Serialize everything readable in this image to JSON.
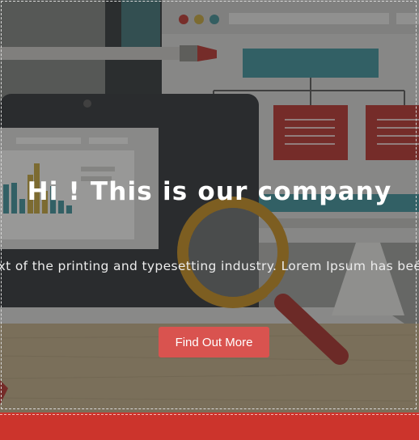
{
  "hero": {
    "headline": "Hi ! This is our company",
    "subtext": "ext of the printing and typesetting industry. Lorem Ipsum has beé",
    "cta_label": "Find Out More",
    "illustration_icon": "laptop-with-magnifier-illustration"
  },
  "colors": {
    "accent": "#d9534f",
    "footer": "#cc342c",
    "headline": "#ffffff"
  }
}
